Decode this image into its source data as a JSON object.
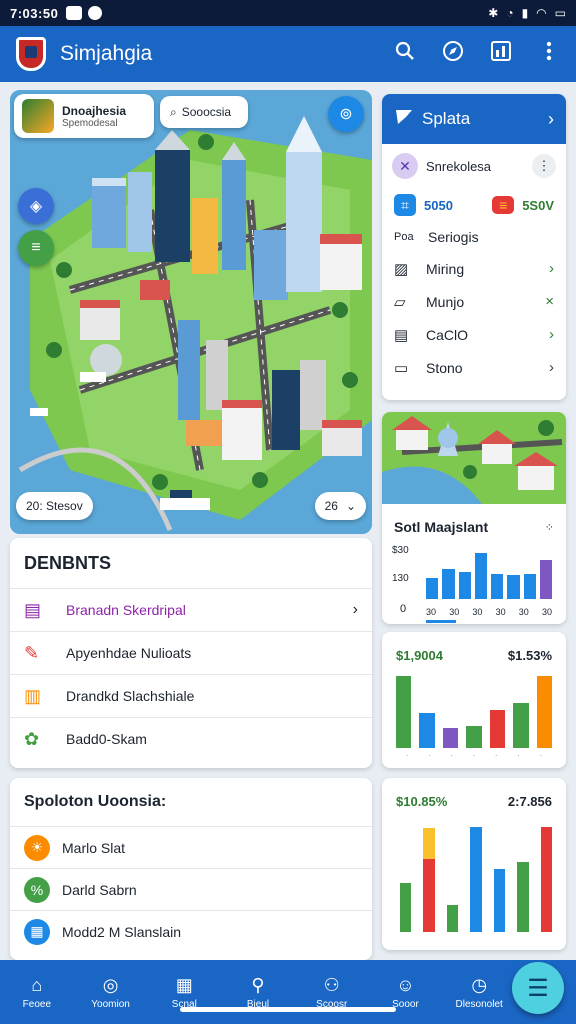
{
  "status_bar": {
    "time": "7:03:50"
  },
  "app_bar": {
    "title": "Simjahgia",
    "actions": [
      "search-icon",
      "compass-icon",
      "chart-icon",
      "more-vert-icon"
    ]
  },
  "map": {
    "city_chip": {
      "line1": "Dnoajhesia",
      "line2": "Spemodesal"
    },
    "search_chip": "Sooocsia",
    "bottom_left_chip": "20: Stesov",
    "bottom_right_chip": "26"
  },
  "tools_panel": {
    "header": "Splata",
    "user_row": "Snrekolesa",
    "stats": [
      "5050",
      "5S0V"
    ],
    "section_label": "Seriogis",
    "section_prefix": "Poa",
    "items": [
      {
        "label": "Miring",
        "icon": "map-icon",
        "chevron": "›",
        "chevron_color": "#2e7d32"
      },
      {
        "label": "Munjo",
        "icon": "ticket-icon",
        "chevron": "×",
        "chevron_color": "#2e7d32"
      },
      {
        "label": "CaClO",
        "icon": "bus-icon",
        "chevron": "›",
        "chevron_color": "#2e7d32"
      },
      {
        "label": "Stono",
        "icon": "tablet-icon",
        "chevron": "›",
        "chevron_color": "#444444"
      }
    ]
  },
  "small_chart": {
    "title": "Sotl Maajslant",
    "y_labels": [
      "$30",
      "130",
      "0"
    ],
    "x_labels": [
      "30",
      "30",
      "30",
      "30",
      "30",
      "30"
    ],
    "chart_data": {
      "type": "bar",
      "values": [
        28,
        40,
        36,
        62,
        34,
        32,
        34,
        52
      ],
      "colors": [
        "#1e88e5",
        "#1e88e5",
        "#1e88e5",
        "#1e88e5",
        "#1e88e5",
        "#1e88e5",
        "#1e88e5",
        "#7e57c2"
      ],
      "ylim": [
        0,
        70
      ]
    }
  },
  "chart2": {
    "left_label": "$1,9004",
    "right_label": "$1.53%",
    "chart_data": {
      "type": "bar",
      "values": [
        72,
        35,
        20,
        22,
        38,
        45,
        72
      ],
      "colors": [
        "#43a047",
        "#1e88e5",
        "#7e57c2",
        "#43a047",
        "#e53935",
        "#43a047",
        "#fb8c00"
      ],
      "ylim": [
        0,
        80
      ]
    }
  },
  "chart3": {
    "left_label": "$10.85%",
    "right_label": "2:7.856",
    "chart_data": {
      "type": "bar",
      "series": [
        {
          "values": [
            50,
            75,
            28,
            108,
            65,
            72,
            108
          ],
          "colors": [
            "#43a047",
            "#e53935",
            "#43a047",
            "#1e88e5",
            "#1e88e5",
            "#43a047",
            "#e53935"
          ]
        },
        {
          "values": [
            0,
            32,
            0,
            0,
            0,
            0,
            0
          ],
          "colors": [
            "#fbc02d",
            "#fbc02d",
            "#fbc02d",
            "#fbc02d",
            "#fbc02d",
            "#fbc02d",
            "#fbc02d"
          ]
        }
      ],
      "ylim": [
        0,
        115
      ]
    }
  },
  "departments": {
    "heading": "DENBNTS",
    "items": [
      {
        "label": "Branadn Skerdripal",
        "icon": "document-icon",
        "color": "#8e24aa",
        "has_chevron": true
      },
      {
        "label": "Apyenhdae Nulioats",
        "icon": "chat-icon",
        "color": "#e53935",
        "has_chevron": false
      },
      {
        "label": "Drandkd Slachshiale",
        "icon": "building-icon",
        "color": "#fb8c00",
        "has_chevron": false
      },
      {
        "label": "Badd0-Skam",
        "icon": "leaf-icon",
        "color": "#43a047",
        "has_chevron": false
      }
    ]
  },
  "solutions": {
    "heading": "Spoloton Uoonsia:",
    "items": [
      {
        "label": "Marlo Slat",
        "icon": "sun-icon",
        "color": "#fb8c00"
      },
      {
        "label": "Darld Sabrn",
        "icon": "percent-icon",
        "color": "#43a047"
      },
      {
        "label": "Modd2 M Slanslain",
        "icon": "calendar-icon",
        "color": "#1e88e5"
      }
    ]
  },
  "bottom_nav": [
    {
      "label": "Feoee",
      "icon": "home-icon"
    },
    {
      "label": "Yoomion",
      "icon": "compass-icon"
    },
    {
      "label": "Scnal",
      "icon": "calendar-icon"
    },
    {
      "label": "Bieul",
      "icon": "map-pin-icon"
    },
    {
      "label": "Scoosr",
      "icon": "group-icon"
    },
    {
      "label": "Sooor",
      "icon": "people-icon"
    },
    {
      "label": "Dlesonolet",
      "icon": "clock-icon"
    }
  ],
  "colors": {
    "primary": "#1a66c4",
    "status": "#0d1b3a",
    "fab": "#4fd0e0"
  }
}
